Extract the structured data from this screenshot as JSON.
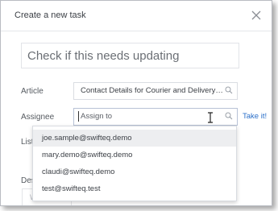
{
  "dialog": {
    "title": "Create a new task",
    "close_icon": "close-icon"
  },
  "task": {
    "title_value": "Check if this needs updating"
  },
  "fields": {
    "article_label": "Article",
    "article_value": "Contact Details for Courier and Delivery Se...",
    "assignee_label": "Assignee",
    "assignee_placeholder": "Assign to",
    "take_it_link": "Take it!",
    "list_label_partial": "List",
    "description_label_partial": "Des",
    "description_placeholder_partial": "W"
  },
  "dropdown": {
    "options": [
      "joe.sample@swifteq.demo",
      "mary.demo@swifteq.demo",
      "claudi@swifteq.demo",
      "test@swifteq.test"
    ]
  },
  "colors": {
    "link": "#2a6fc9",
    "hover": "#edeef0"
  }
}
